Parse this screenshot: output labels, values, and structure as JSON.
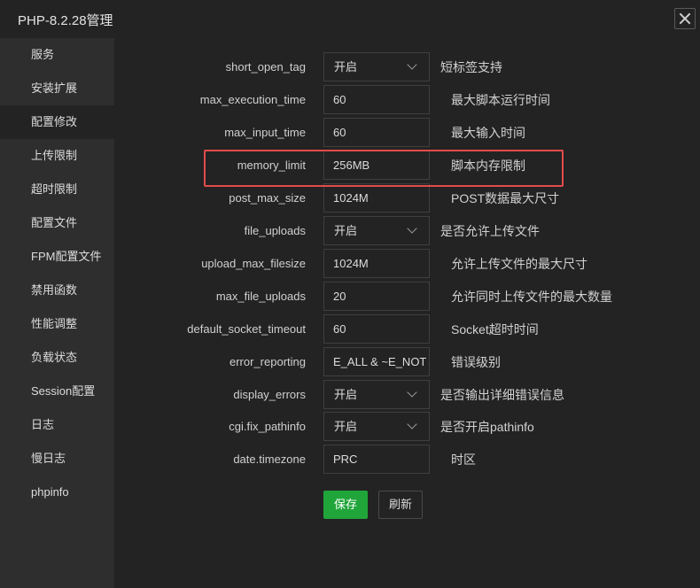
{
  "window": {
    "title": "PHP-8.2.28管理"
  },
  "sidebar": {
    "items": [
      {
        "label": "服务"
      },
      {
        "label": "安装扩展"
      },
      {
        "label": "配置修改",
        "active": true
      },
      {
        "label": "上传限制"
      },
      {
        "label": "超时限制"
      },
      {
        "label": "配置文件"
      },
      {
        "label": "FPM配置文件"
      },
      {
        "label": "禁用函数"
      },
      {
        "label": "性能调整"
      },
      {
        "label": "负载状态"
      },
      {
        "label": "Session配置"
      },
      {
        "label": "日志"
      },
      {
        "label": "慢日志"
      },
      {
        "label": "phpinfo"
      }
    ]
  },
  "settings": [
    {
      "name": "short_open_tag",
      "type": "select",
      "value": "开启",
      "desc": "短标签支持"
    },
    {
      "name": "max_execution_time",
      "type": "input",
      "value": "60",
      "desc": "最大脚本运行时间"
    },
    {
      "name": "max_input_time",
      "type": "input",
      "value": "60",
      "desc": "最大输入时间"
    },
    {
      "name": "memory_limit",
      "type": "input",
      "value": "256MB",
      "desc": "脚本内存限制",
      "highlighted": true
    },
    {
      "name": "post_max_size",
      "type": "input",
      "value": "1024M",
      "desc": "POST数据最大尺寸"
    },
    {
      "name": "file_uploads",
      "type": "select",
      "value": "开启",
      "desc": "是否允许上传文件"
    },
    {
      "name": "upload_max_filesize",
      "type": "input",
      "value": "1024M",
      "desc": "允许上传文件的最大尺寸"
    },
    {
      "name": "max_file_uploads",
      "type": "input",
      "value": "20",
      "desc": "允许同时上传文件的最大数量"
    },
    {
      "name": "default_socket_timeout",
      "type": "input",
      "value": "60",
      "desc": "Socket超时时间"
    },
    {
      "name": "error_reporting",
      "type": "input",
      "value": "E_ALL & ~E_NOT",
      "desc": "错误级别"
    },
    {
      "name": "display_errors",
      "type": "select",
      "value": "开启",
      "desc": "是否输出详细错误信息"
    },
    {
      "name": "cgi.fix_pathinfo",
      "type": "select",
      "value": "开启",
      "desc": "是否开启pathinfo"
    },
    {
      "name": "date.timezone",
      "type": "input",
      "value": "PRC",
      "desc": "时区"
    }
  ],
  "buttons": {
    "save": "保存",
    "refresh": "刷新"
  },
  "colors": {
    "accent": "#20a53a",
    "highlight_border": "#e24c4c",
    "background": "#232323",
    "sidebar": "#2e2e2e"
  },
  "icons": {
    "close": "close-icon",
    "dropdown": "chevron-down-icon"
  }
}
